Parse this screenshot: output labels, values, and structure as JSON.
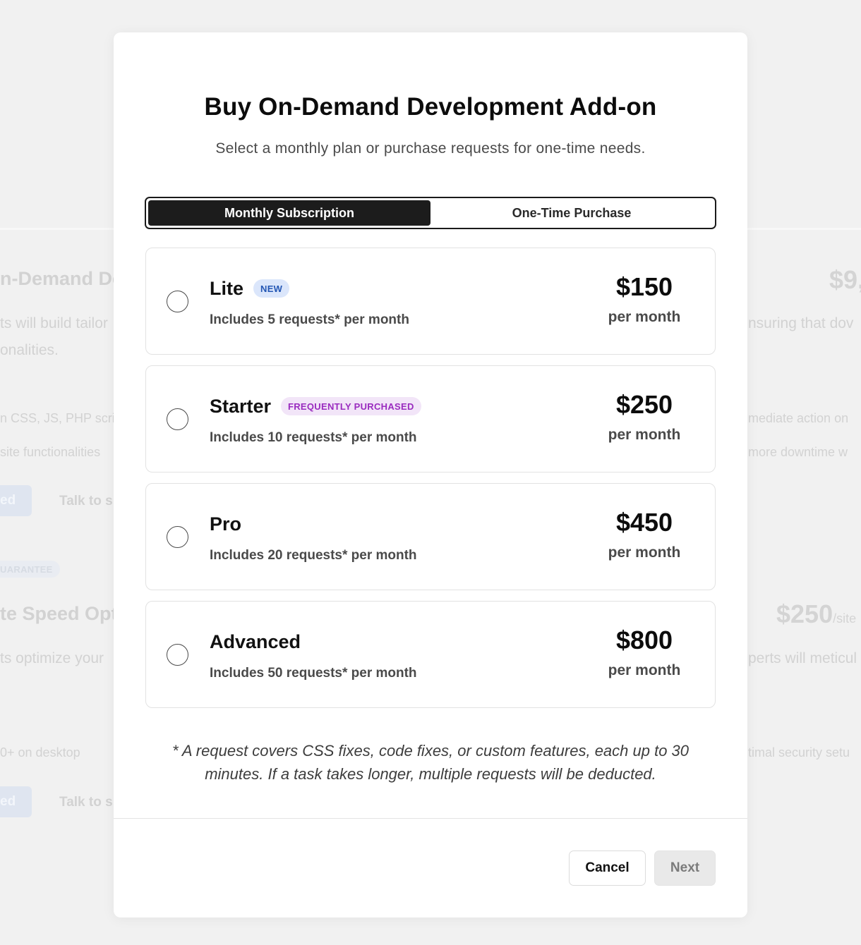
{
  "background": {
    "left_title": "n-Demand Dev",
    "left_para_1": "ts will build tailor",
    "left_para_2": "onalities.",
    "left_item_1": "n CSS, JS, PHP scri",
    "left_item_2": "site functionalities",
    "left_button_1": "ed",
    "left_talk_1": "Talk to s",
    "left_badge": "UARANTEE",
    "left_title_2": "te Speed Opti",
    "left_para_3": "ts optimize your",
    "left_item_3": "0+ on desktop",
    "left_button_2": "ed",
    "left_talk_2": "Talk to s",
    "right_price_1": "$9,",
    "right_para_1": "nsuring that dov",
    "right_item_1": "mediate action on",
    "right_item_2": "more downtime w",
    "right_price_2": "$250",
    "right_price_2_unit": "/site",
    "right_para_2": "perts will meticul",
    "right_item_3": "timal security setu"
  },
  "modal": {
    "title": "Buy On-Demand Development Add-on",
    "subtitle": "Select a monthly plan or purchase requests for one-time needs.",
    "tabs": [
      {
        "label": "Monthly Subscription",
        "active": true
      },
      {
        "label": "One-Time Purchase",
        "active": false
      }
    ],
    "plans": [
      {
        "name": "Lite",
        "badge": "NEW",
        "description": "Includes 5 requests* per month",
        "price": "$150",
        "period": "per month",
        "selected": false
      },
      {
        "name": "Starter",
        "badge": "FREQUENTLY PURCHASED",
        "description": "Includes 10 requests* per month",
        "price": "$250",
        "period": "per month",
        "selected": false
      },
      {
        "name": "Pro",
        "badge": "",
        "description": "Includes 20 requests* per month",
        "price": "$450",
        "period": "per month",
        "selected": false
      },
      {
        "name": "Advanced",
        "badge": "",
        "description": "Includes 50 requests* per month",
        "price": "$800",
        "period": "per month",
        "selected": false
      }
    ],
    "footnote": "* A request covers CSS fixes, code fixes, or custom features, each up to 30 minutes. If a task takes longer, multiple requests will be deducted.",
    "buttons": {
      "cancel": "Cancel",
      "next": "Next"
    }
  },
  "colors": {
    "backdrop": "#f1f1f1",
    "active_tab": "#1c1c1c",
    "badge_new_bg": "#dbe6fb",
    "badge_new_text": "#2457b4",
    "badge_freq_bg": "#f2e5f8",
    "badge_freq_text": "#9a2bbf",
    "next_disabled_bg": "#e9e9e9"
  }
}
